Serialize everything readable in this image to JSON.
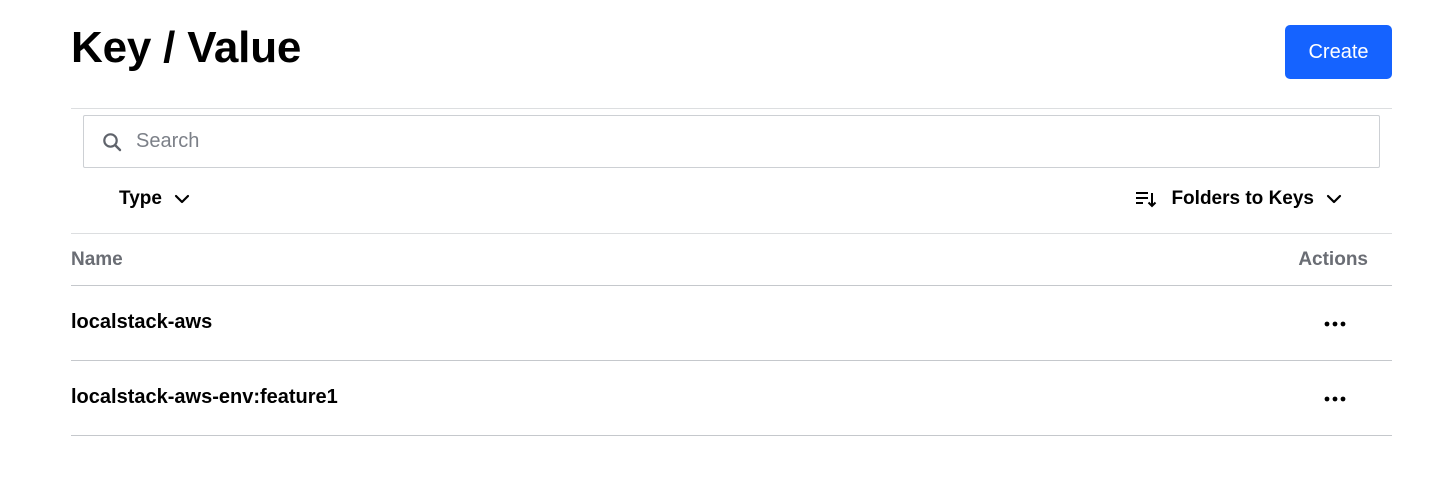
{
  "header": {
    "title": "Key / Value",
    "create_label": "Create"
  },
  "search": {
    "placeholder": "Search",
    "value": "",
    "icon": "search-icon"
  },
  "filters": {
    "type_label": "Type",
    "sort_label": "Folders to Keys",
    "sort_icon": "sort-icon"
  },
  "table": {
    "columns": [
      "Name",
      "Actions"
    ],
    "rows": [
      {
        "name": "localstack-aws"
      },
      {
        "name": "localstack-aws-env:feature1"
      }
    ]
  },
  "colors": {
    "accent": "#1563ff",
    "border": "#dcdee0",
    "muted_text": "#6a6d74"
  }
}
